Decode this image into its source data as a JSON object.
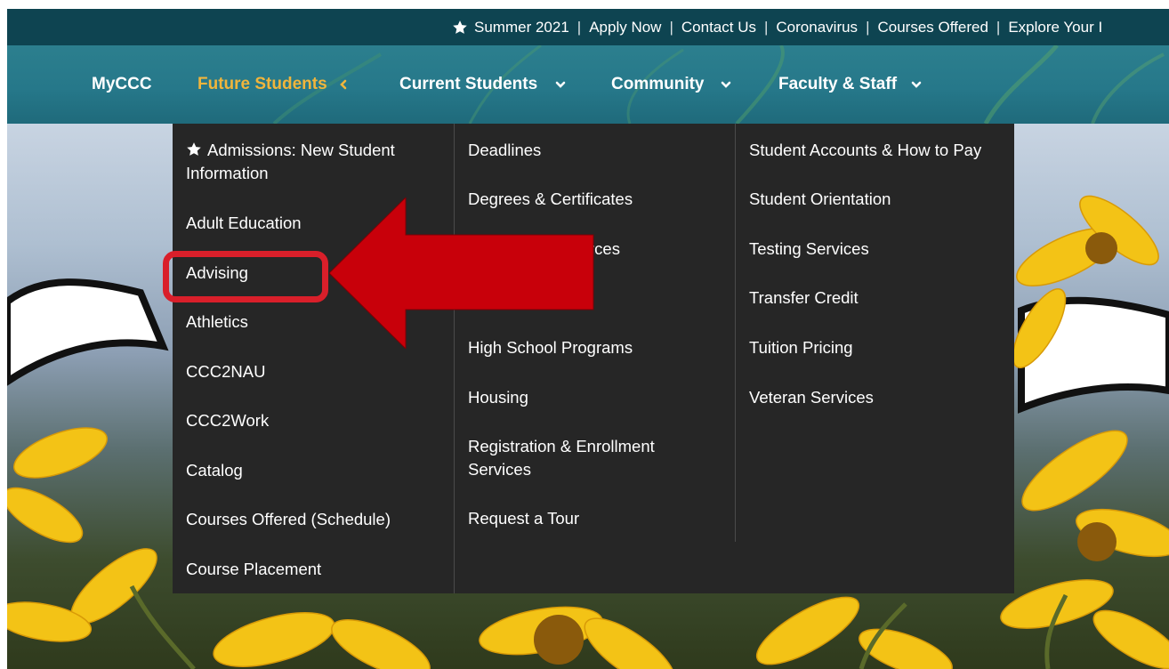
{
  "utility_bar": {
    "items": [
      "Summer 2021",
      "Apply Now",
      "Contact Us",
      "Coronavirus",
      "Courses Offered",
      "Explore Your I"
    ]
  },
  "main_nav": {
    "items": [
      {
        "label": "MyCCC"
      },
      {
        "label": "Future Students"
      },
      {
        "label": "Current Students"
      },
      {
        "label": "Community"
      },
      {
        "label": "Faculty & Staff"
      }
    ]
  },
  "dropdown": {
    "column1": [
      "Admissions: New Student Information",
      "Adult Education",
      "Advising",
      "Athletics",
      "CCC2NAU",
      "CCC2Work",
      "Catalog",
      "Courses Offered (Schedule)",
      "Course Placement"
    ],
    "column2": [
      "Deadlines",
      "Degrees & Certificates",
      "rces",
      "High School Programs",
      "Housing",
      "Registration & Enrollment Services",
      "Request a Tour"
    ],
    "column3": [
      "Student Accounts & How to Pay",
      "Student Orientation",
      "Testing Services",
      "Transfer Credit",
      "Tuition Pricing",
      "Veteran Services"
    ]
  },
  "colors": {
    "utility_bg": "#0e4451",
    "nav_bg": "#2c7f8e",
    "active_nav": "#f0b53c",
    "dropdown_bg": "#262626",
    "annotation_red": "#c8000a"
  },
  "icons": {
    "utility_star": "star-icon",
    "admissions_star": "star-icon",
    "nav_chevrons": "chevron-down-icon",
    "active_chevron": "chevron-left-icon"
  }
}
